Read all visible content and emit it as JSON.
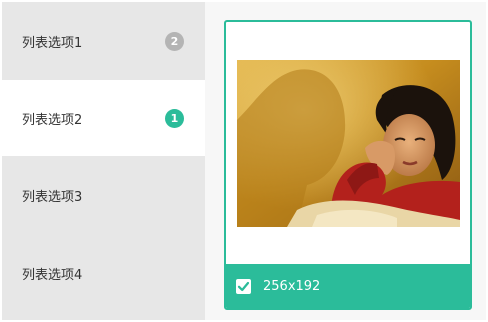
{
  "list": {
    "items": [
      {
        "label": "列表选项1",
        "badge": "2",
        "badge_color": "#b4b4b4"
      },
      {
        "label": "列表选项2",
        "badge": "1",
        "badge_color": "#2bbc9a"
      },
      {
        "label": "列表选项3"
      },
      {
        "label": "列表选项4"
      }
    ],
    "selected_item": "列表选项2"
  },
  "preview": {
    "dimensions": "256x192",
    "checked": true,
    "accent_color": "#2bbc9a",
    "checkbox_icon": "check-icon"
  }
}
